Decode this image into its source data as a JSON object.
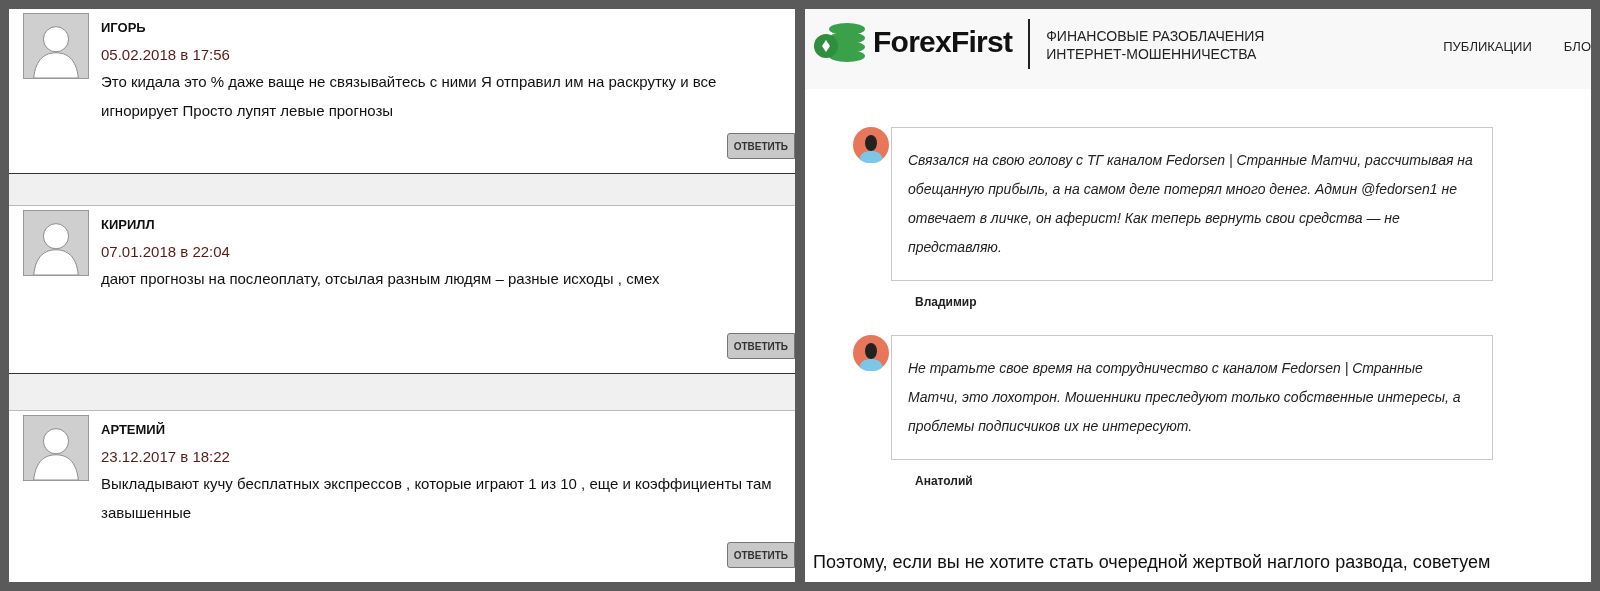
{
  "left_panel": {
    "comments": [
      {
        "author": "ИГОРЬ",
        "date": "05.02.2018 в 17:56",
        "text": "Это кидала это % даже ваще не связывайтесь с ними Я отправил им на раскрутку и все игнорирует Просто лупят левые прогнозы",
        "reply_label": "ОТВЕТИТЬ"
      },
      {
        "author": "КИРИЛЛ",
        "date": "07.01.2018 в 22:04",
        "text": "дают прогнозы на послеоплату, отсылая разным людям – разные исходы , смех",
        "reply_label": "ОТВЕТИТЬ"
      },
      {
        "author": "АРТЕМИЙ",
        "date": "23.12.2017 в 18:22",
        "text": "Выкладывают кучу бесплатных экспрессов , которые играют 1 из 10 , еще и коэффициенты там завышенные",
        "reply_label": "ОТВЕТИТЬ"
      }
    ]
  },
  "right_panel": {
    "header": {
      "logo": "ForexFirst",
      "tagline": [
        "ФИНАНСОВЫЕ РАЗОБЛАЧЕНИЯ",
        "ИНТЕРНЕТ-МОШЕННИЧЕСТВА"
      ],
      "nav": [
        "ПУБЛИКАЦИИ",
        "БЛО"
      ]
    },
    "reviews": [
      {
        "text": "Связался на свою голову с ТГ каналом Fedorsen | Странные Матчи, рассчитывая на обещанную прибыль, а на самом деле потерял много денег. Админ @fedorsen1 не отвечает в личке, он аферист! Как теперь вернуть свои средства — не представляю.",
        "author": "Владимир"
      },
      {
        "text": "Не тратьте свое время на сотрудничество с каналом Fedorsen | Странные Матчи, это лохотрон. Мошенники преследуют только собственные интересы, а проблемы подписчиков их не интересуют.",
        "author": "Анатолий"
      }
    ],
    "paragraph": "Поэтому, если вы не хотите стать очередной жертвой наглого развода, советуем"
  }
}
